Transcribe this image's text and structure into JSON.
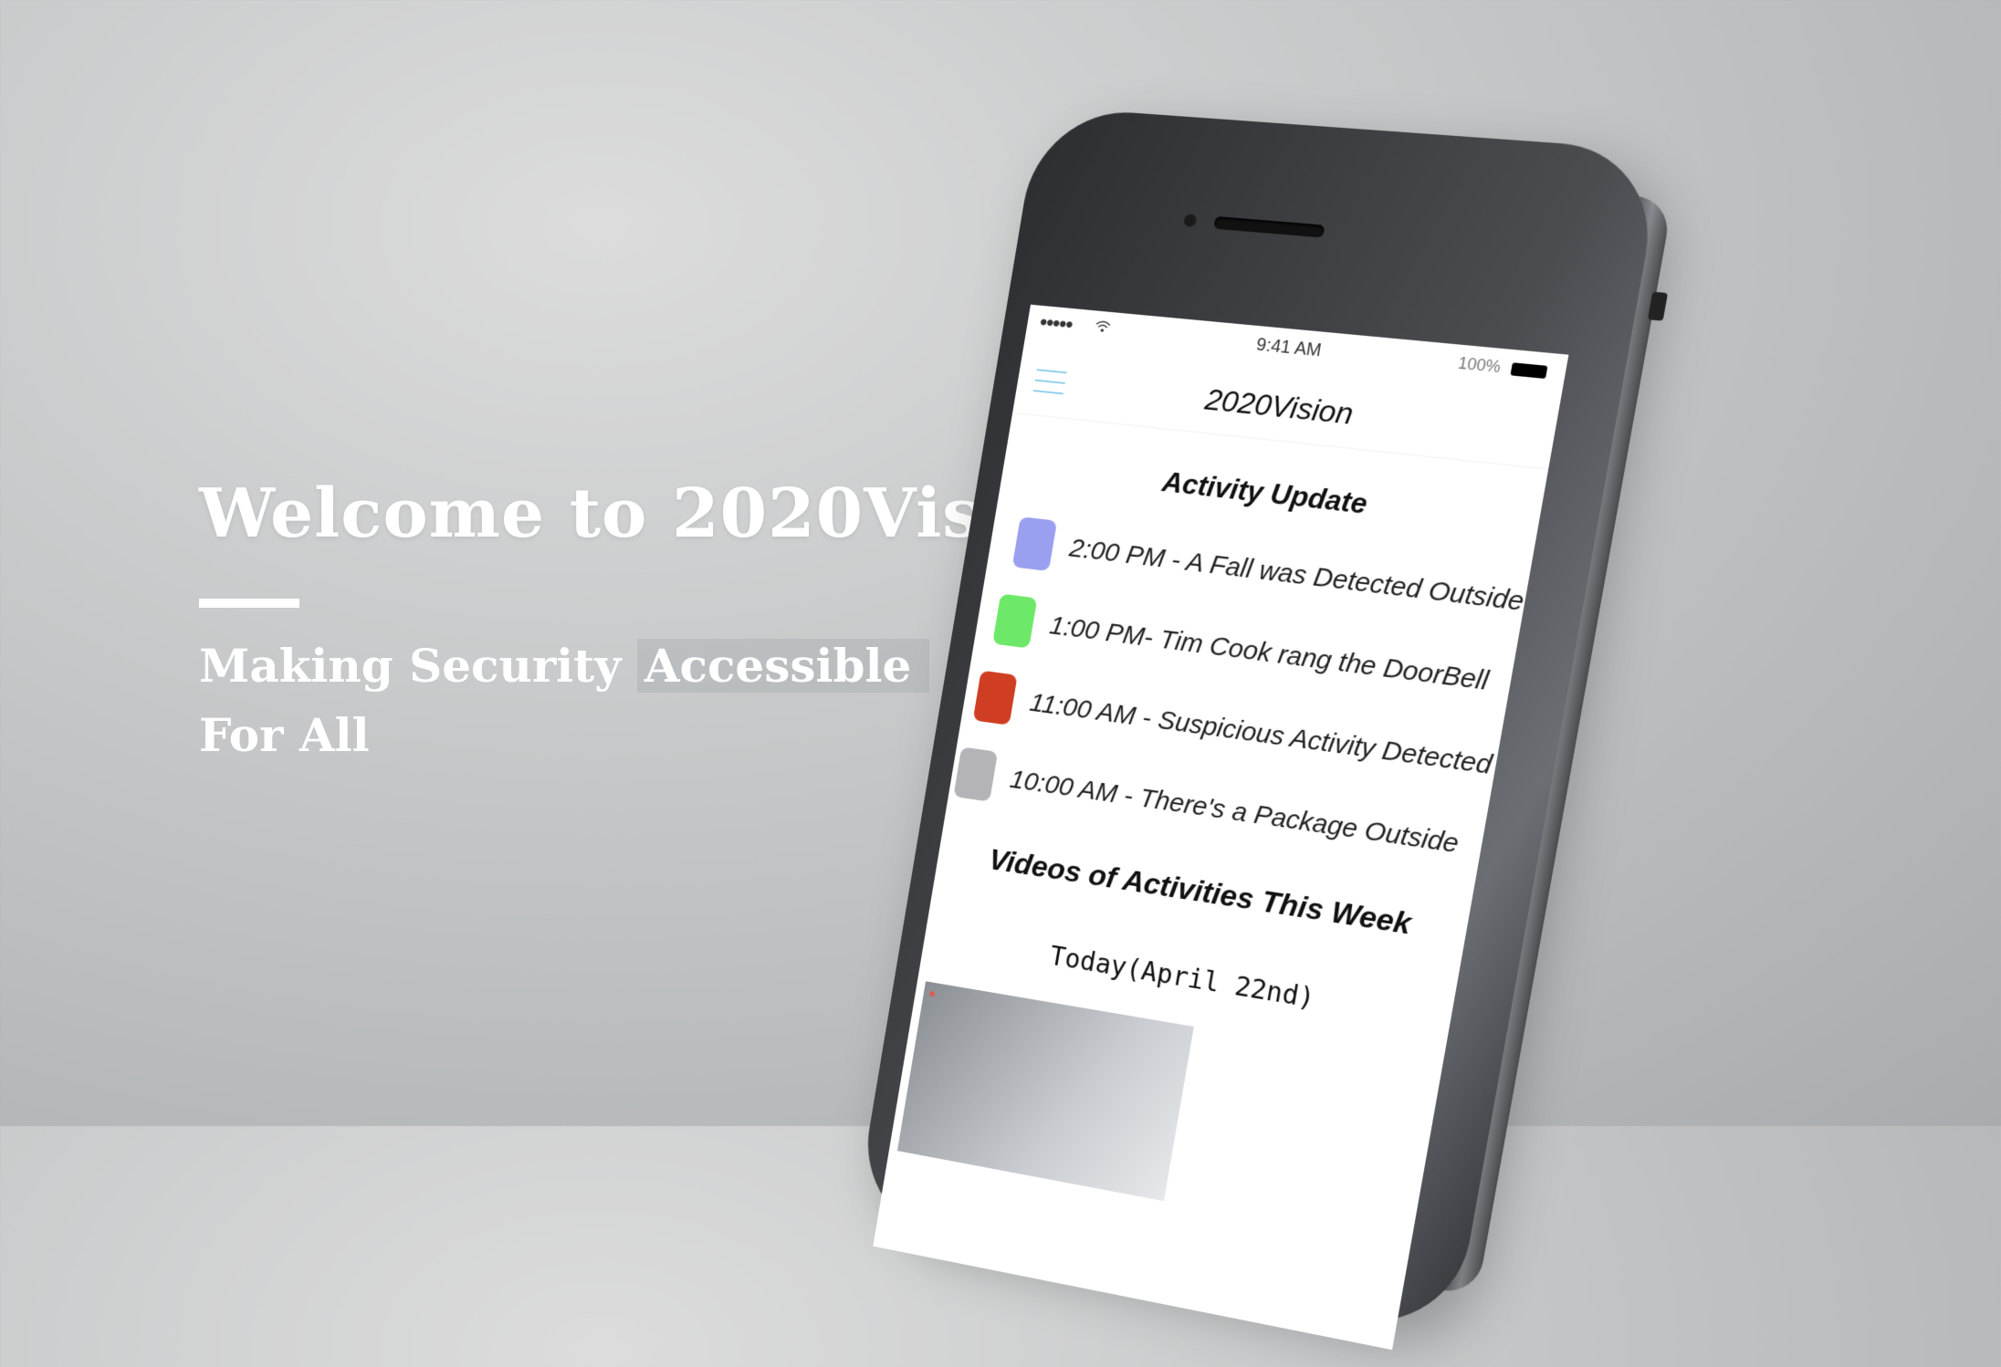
{
  "hero": {
    "title": "Welcome to 2020Vision",
    "subtitle_line1_part1": "Making Security",
    "subtitle_line1_part2": "Accessible",
    "subtitle_line2": "For All"
  },
  "phone": {
    "status_bar": {
      "signal": "●●●●●",
      "time": "9:41 AM",
      "battery": "100%"
    },
    "app_title": "2020Vision",
    "activity_title": "Activity Update",
    "activities": [
      {
        "text": "2:00 PM - A Fall was Detected Outside",
        "color": "#9b9ff0"
      },
      {
        "text": "1:00 PM- Tim Cook rang the DoorBell",
        "color": "#6ee868"
      },
      {
        "text": "11:00 AM - Suspicious Activity Detected",
        "color": "#cf3e22"
      },
      {
        "text": "10:00 AM - There's a Package Outside",
        "color": "#b4b4b8"
      }
    ],
    "videos_title": "Videos of Activities This Week",
    "date_label": "Today(April 22nd)"
  }
}
